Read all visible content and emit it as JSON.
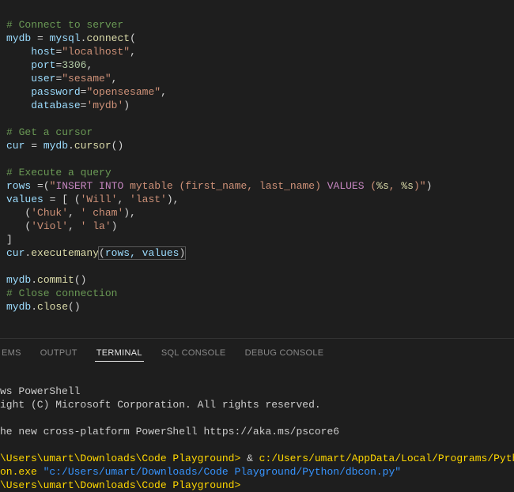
{
  "editor": {
    "l1": "# Connect to server",
    "l2a": "mydb",
    "l2b": " = ",
    "l2c": "mysql",
    "l2d": ".",
    "l2e": "connect",
    "l2f": "(",
    "l3a": "    ",
    "l3b": "host",
    "l3c": "=",
    "l3d": "\"localhost\"",
    "l3e": ",",
    "l4a": "    ",
    "l4b": "port",
    "l4c": "=",
    "l4d": "3306",
    "l4e": ",",
    "l5a": "    ",
    "l5b": "user",
    "l5c": "=",
    "l5d": "\"sesame\"",
    "l5e": ",",
    "l6a": "    ",
    "l6b": "password",
    "l6c": "=",
    "l6d": "\"opensesame\"",
    "l6e": ",",
    "l7a": "    ",
    "l7b": "database",
    "l7c": "=",
    "l7d": "'mydb'",
    "l7e": ")",
    "l9": "# Get a cursor",
    "l10a": "cur",
    "l10b": " = ",
    "l10c": "mydb",
    "l10d": ".",
    "l10e": "cursor",
    "l10f": "()",
    "l12": "# Execute a query",
    "l13a": "rows",
    "l13b": " =(",
    "l13c1": "\"",
    "l13c2": "INSERT INTO",
    "l13c3": " mytable (first_name, last_name) ",
    "l13c4": "VALUES",
    "l13c5": " (",
    "l13c6": "%s",
    "l13c7": ", ",
    "l13c8": "%s",
    "l13c9": ")\"",
    "l13d": ")",
    "l14a": "values",
    "l14b": " = [ (",
    "l14c": "'Will'",
    "l14d": ", ",
    "l14e": "'last'",
    "l14f": "),",
    "l15a": "   (",
    "l15b": "'Chuk'",
    "l15c": ", ",
    "l15d": "' cham'",
    "l15e": "),",
    "l16a": "   (",
    "l16b": "'Viol'",
    "l16c": ", ",
    "l16d": "' la'",
    "l16e": ")",
    "l17": "]",
    "l18a": "cur",
    "l18b": ".",
    "l18c": "executemany",
    "l18d": "(",
    "l18e": "rows, values",
    "l18f": ")",
    "l20a": "mydb",
    "l20b": ".",
    "l20c": "commit",
    "l20d": "()",
    "l21": "# Close connection",
    "l22a": "mydb",
    "l22b": ".",
    "l22c": "close",
    "l22d": "()"
  },
  "tabs": {
    "problems": "EMS",
    "output": "OUTPUT",
    "terminal": "TERMINAL",
    "sqlconsole": "SQL CONSOLE",
    "debugconsole": "DEBUG CONSOLE"
  },
  "terminal": {
    "l1": "ws PowerShell",
    "l2": "ight (C) Microsoft Corporation. All rights reserved.",
    "l3": "",
    "l4": "he new cross-platform PowerShell https://aka.ms/pscore6",
    "l5": "",
    "l6a": "\\Users\\umart\\Downloads\\Code Playground> ",
    "l6b": "& ",
    "l6c": "c:/Users/umart/AppData/Local/Programs/Python/Python",
    "l7a": "on.exe ",
    "l7b": "\"c:/Users/umart/Downloads/Code Playground/Python/dbcon.py\"",
    "l8": "\\Users\\umart\\Downloads\\Code Playground>"
  }
}
